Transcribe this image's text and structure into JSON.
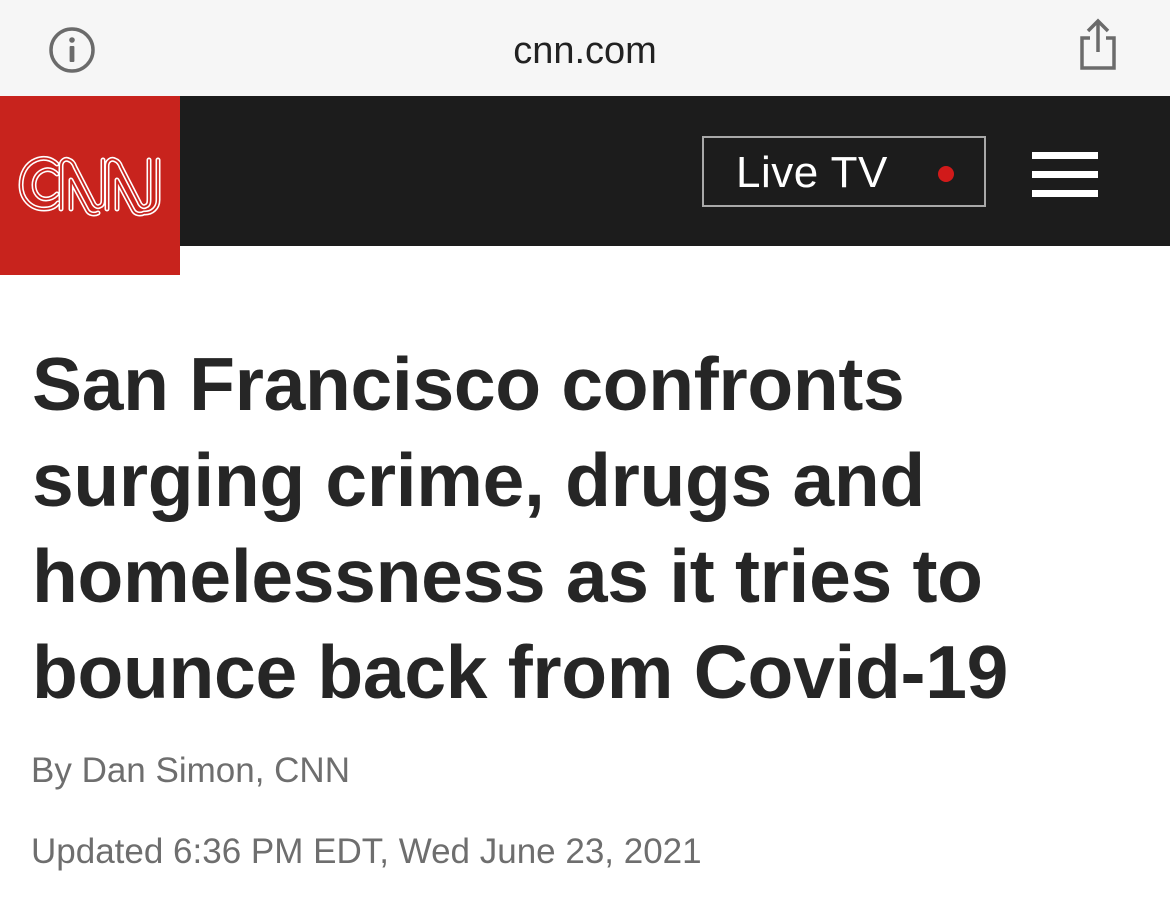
{
  "browser": {
    "url": "cnn.com",
    "info_icon": "info-circle-icon",
    "share_icon": "share-icon"
  },
  "header": {
    "logo_text": "CNN",
    "live_tv_label": "Live TV",
    "menu_icon": "hamburger-menu-icon",
    "brand_color": "#c8231d",
    "header_color": "#1c1c1c",
    "live_dot_color": "#d11a1a"
  },
  "article": {
    "headline_lines": [
      "San Francisco confronts",
      "surging crime, drugs and",
      "homelessness as it tries to",
      "bounce back from Covid-19"
    ],
    "byline": "By Dan Simon, CNN",
    "updated": "Updated 6:36 PM EDT, Wed June 23, 2021"
  }
}
